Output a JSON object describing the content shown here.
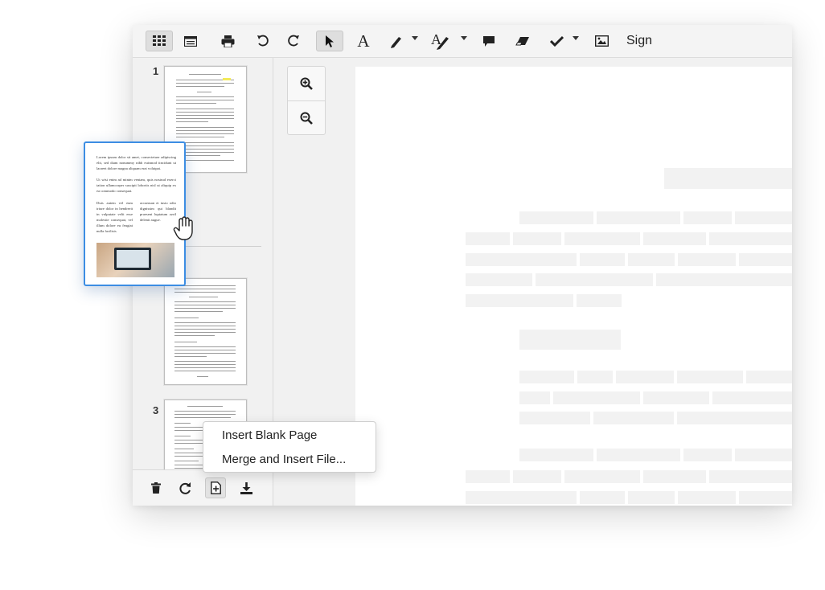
{
  "toolbar": {
    "sign_label": "Sign",
    "tools": [
      "thumbnails-icon",
      "outline-icon",
      "print-icon",
      "undo-icon",
      "redo-icon",
      "select-arrow-icon",
      "text-icon",
      "pen-icon",
      "signature-pen-icon",
      "comment-icon",
      "eraser-icon",
      "checkmark-icon",
      "image-icon"
    ],
    "text_tool_glyph": "A"
  },
  "thumbnails": {
    "page_numbers": [
      "1",
      "3"
    ]
  },
  "drag_preview": {
    "paragraph_1": "Lorem ipsum dolor sit amet, consectetuer adipiscing elit, sed diam nonummy nibh euismod tincidunt ut laoreet dolore magna aliquam erat volutpat.",
    "paragraph_2": "Ut wisi enim ad minim veniam, quis nostrud exerci tation ullamcorper suscipit lobortis nisl ut aliquip ex ea commodo consequat.",
    "col_left": "Duis autem vel eum iriure dolor in hendrerit in vulputate velit esse molestie consequat, vel illum dolore eu feugiat nulla facilisis",
    "col_right": "accumsan et iusto odio dignissim qui blandit praesent luptatum zzril delenit augue."
  },
  "context_menu": {
    "insert_blank_page": "Insert Blank Page",
    "merge_insert_file": "Merge and Insert File..."
  },
  "colors": {
    "accent": "#3c8de3",
    "highlight": "#f3ea5a"
  }
}
